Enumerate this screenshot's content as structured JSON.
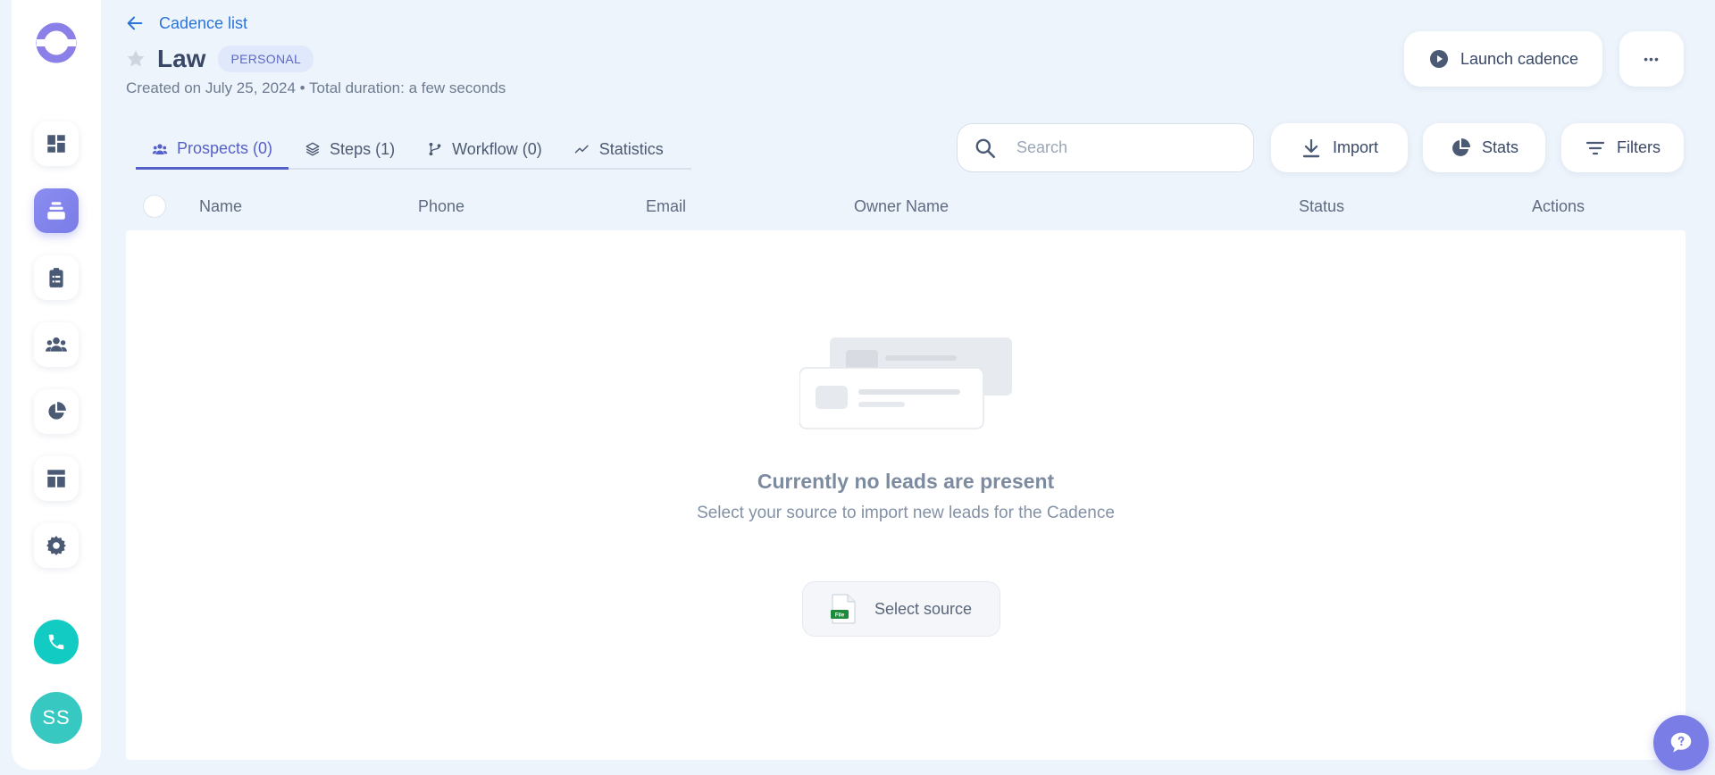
{
  "nav": {
    "back_label": "Cadence list"
  },
  "cadence": {
    "title": "Law",
    "badge": "PERSONAL",
    "subtitle": "Created on July 25, 2024 • Total duration: a few seconds"
  },
  "actions": {
    "launch_label": "Launch cadence",
    "more_label": "•••"
  },
  "tabs": [
    {
      "label": "Prospects (0)",
      "icon": "people-icon",
      "active": true
    },
    {
      "label": "Steps (1)",
      "icon": "layers-icon",
      "active": false
    },
    {
      "label": "Workflow (0)",
      "icon": "workflow-icon",
      "active": false
    },
    {
      "label": "Statistics",
      "icon": "trend-icon",
      "active": false
    }
  ],
  "toolbar": {
    "search_placeholder": "Search",
    "import_label": "Import",
    "stats_label": "Stats",
    "filters_label": "Filters"
  },
  "table": {
    "columns": [
      "Name",
      "Phone",
      "Email",
      "Owner Name",
      "Status",
      "Actions"
    ]
  },
  "empty_state": {
    "title": "Currently no leads are present",
    "subtitle": "Select your source to import new leads for the Cadence",
    "button_label": "Select source",
    "file_icon_label": "File"
  },
  "user": {
    "initials": "SS"
  },
  "colors": {
    "accent": "#5560c8",
    "link": "#2a74d8",
    "sidebar_active": "#8b8df0",
    "call": "#12cbc3",
    "avatar": "#37c9c1"
  }
}
